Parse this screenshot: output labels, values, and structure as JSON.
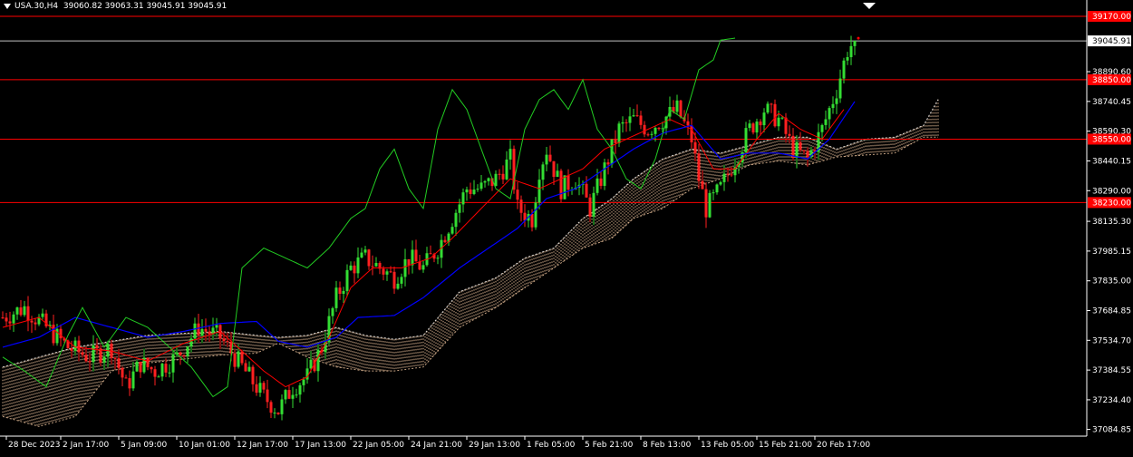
{
  "header": {
    "symbol": "USA.30,H4",
    "ohlc": "39060.82 39063.31 39045.91 39045.91"
  },
  "colors": {
    "background": "#000000",
    "axis": "#ffffff",
    "bull": "#33dd33",
    "bear": "#ff2020",
    "tenkan": "#ff0000",
    "kijun": "#0000ff",
    "chikou": "#22cc22",
    "cloud": "#f4c8a0",
    "hline": "#ff0000",
    "bid_line": "#c0c0c0"
  },
  "chart_data": {
    "type": "candlestick",
    "title": "USA.30,H4",
    "ylim": [
      37084.85,
      39200.0
    ],
    "y_ticks": [
      "39170.00",
      "39045.91",
      "38890.60",
      "38850.00",
      "38740.45",
      "38590.30",
      "38550.00",
      "38440.15",
      "38290.00",
      "38230.00",
      "38135.30",
      "37985.15",
      "37835.00",
      "37684.85",
      "37534.70",
      "37384.55",
      "37234.40",
      "37084.85"
    ],
    "y_tick_values": [
      39170.0,
      39045.91,
      38890.6,
      38850.0,
      38740.45,
      38590.3,
      38550.0,
      38440.15,
      38290.0,
      38230.0,
      38135.3,
      37985.15,
      37835.0,
      37684.85,
      37534.7,
      37384.55,
      37234.4,
      37084.85
    ],
    "x_ticks": [
      "28 Dec 2023",
      "2 Jan 17:00",
      "5 Jan 09:00",
      "10 Jan 01:00",
      "12 Jan 17:00",
      "17 Jan 13:00",
      "22 Jan 05:00",
      "24 Jan 21:00",
      "29 Jan 13:00",
      "1 Feb 05:00",
      "5 Feb 21:00",
      "8 Feb 13:00",
      "13 Feb 05:00",
      "15 Feb 21:00",
      "20 Feb 17:00"
    ],
    "x_tick_index": [
      1,
      16,
      32,
      48,
      64,
      80,
      96,
      112,
      128,
      144,
      160,
      176,
      192,
      208,
      224
    ],
    "horizontal_lines": [
      {
        "price": 39170.0,
        "label": "39170.00"
      },
      {
        "price": 38850.0,
        "label": "38850.00"
      },
      {
        "price": 38550.0,
        "label": "38550.00"
      },
      {
        "price": 38230.0,
        "label": "38230.00"
      }
    ],
    "bid": {
      "price": 39045.91,
      "label": "39045.91"
    },
    "close_path": [
      [
        0,
        37650
      ],
      [
        6,
        37700
      ],
      [
        12,
        37600
      ],
      [
        18,
        37500
      ],
      [
        24,
        37450
      ],
      [
        30,
        37500
      ],
      [
        34,
        37300
      ],
      [
        38,
        37420
      ],
      [
        42,
        37380
      ],
      [
        48,
        37450
      ],
      [
        54,
        37600
      ],
      [
        60,
        37550
      ],
      [
        64,
        37450
      ],
      [
        68,
        37350
      ],
      [
        72,
        37250
      ],
      [
        76,
        37180
      ],
      [
        80,
        37300
      ],
      [
        84,
        37350
      ],
      [
        88,
        37500
      ],
      [
        92,
        37750
      ],
      [
        96,
        37900
      ],
      [
        100,
        37950
      ],
      [
        104,
        37900
      ],
      [
        108,
        37850
      ],
      [
        112,
        37950
      ],
      [
        116,
        37900
      ],
      [
        120,
        38000
      ],
      [
        124,
        38150
      ],
      [
        128,
        38300
      ],
      [
        132,
        38300
      ],
      [
        136,
        38350
      ],
      [
        140,
        38450
      ],
      [
        142,
        38200
      ],
      [
        146,
        38150
      ],
      [
        148,
        38400
      ],
      [
        150,
        38500
      ],
      [
        154,
        38300
      ],
      [
        158,
        38350
      ],
      [
        162,
        38200
      ],
      [
        166,
        38400
      ],
      [
        170,
        38600
      ],
      [
        174,
        38650
      ],
      [
        178,
        38600
      ],
      [
        182,
        38650
      ],
      [
        186,
        38700
      ],
      [
        190,
        38550
      ],
      [
        192,
        38350
      ],
      [
        194,
        38200
      ],
      [
        198,
        38300
      ],
      [
        202,
        38450
      ],
      [
        206,
        38600
      ],
      [
        210,
        38700
      ],
      [
        214,
        38650
      ],
      [
        218,
        38500
      ],
      [
        222,
        38450
      ],
      [
        226,
        38600
      ],
      [
        230,
        38800
      ],
      [
        233,
        39000
      ],
      [
        235,
        39046
      ]
    ],
    "tenkan_path": [
      [
        0,
        37600
      ],
      [
        10,
        37650
      ],
      [
        20,
        37500
      ],
      [
        30,
        37480
      ],
      [
        40,
        37430
      ],
      [
        50,
        37520
      ],
      [
        60,
        37580
      ],
      [
        66,
        37480
      ],
      [
        72,
        37380
      ],
      [
        78,
        37300
      ],
      [
        84,
        37350
      ],
      [
        90,
        37550
      ],
      [
        96,
        37800
      ],
      [
        102,
        37900
      ],
      [
        110,
        37900
      ],
      [
        118,
        37950
      ],
      [
        124,
        38050
      ],
      [
        132,
        38200
      ],
      [
        140,
        38350
      ],
      [
        148,
        38300
      ],
      [
        154,
        38350
      ],
      [
        160,
        38400
      ],
      [
        166,
        38500
      ],
      [
        172,
        38550
      ],
      [
        178,
        38600
      ],
      [
        184,
        38650
      ],
      [
        190,
        38600
      ],
      [
        196,
        38400
      ],
      [
        202,
        38400
      ],
      [
        208,
        38550
      ],
      [
        214,
        38680
      ],
      [
        220,
        38600
      ],
      [
        226,
        38550
      ],
      [
        232,
        38700
      ]
    ],
    "kijun_path": [
      [
        0,
        37500
      ],
      [
        10,
        37550
      ],
      [
        20,
        37650
      ],
      [
        30,
        37600
      ],
      [
        40,
        37550
      ],
      [
        50,
        37580
      ],
      [
        60,
        37620
      ],
      [
        70,
        37630
      ],
      [
        76,
        37530
      ],
      [
        84,
        37500
      ],
      [
        92,
        37550
      ],
      [
        98,
        37650
      ],
      [
        108,
        37660
      ],
      [
        116,
        37750
      ],
      [
        126,
        37900
      ],
      [
        134,
        38000
      ],
      [
        142,
        38100
      ],
      [
        150,
        38250
      ],
      [
        158,
        38300
      ],
      [
        166,
        38400
      ],
      [
        174,
        38500
      ],
      [
        182,
        38580
      ],
      [
        190,
        38620
      ],
      [
        198,
        38450
      ],
      [
        206,
        38480
      ],
      [
        214,
        38480
      ],
      [
        222,
        38450
      ],
      [
        228,
        38550
      ],
      [
        235,
        38740
      ]
    ],
    "chikou_path": [
      [
        0,
        37450
      ],
      [
        6,
        37380
      ],
      [
        12,
        37300
      ],
      [
        18,
        37560
      ],
      [
        22,
        37700
      ],
      [
        28,
        37500
      ],
      [
        34,
        37650
      ],
      [
        40,
        37600
      ],
      [
        46,
        37500
      ],
      [
        52,
        37400
      ],
      [
        58,
        37250
      ],
      [
        62,
        37300
      ],
      [
        66,
        37900
      ],
      [
        72,
        38000
      ],
      [
        78,
        37950
      ],
      [
        84,
        37900
      ],
      [
        90,
        38000
      ],
      [
        96,
        38150
      ],
      [
        100,
        38200
      ],
      [
        104,
        38400
      ],
      [
        108,
        38500
      ],
      [
        112,
        38300
      ],
      [
        116,
        38200
      ],
      [
        120,
        38600
      ],
      [
        124,
        38800
      ],
      [
        128,
        38700
      ],
      [
        132,
        38500
      ],
      [
        136,
        38300
      ],
      [
        140,
        38250
      ],
      [
        144,
        38600
      ],
      [
        148,
        38750
      ],
      [
        152,
        38800
      ],
      [
        156,
        38700
      ],
      [
        160,
        38850
      ],
      [
        164,
        38600
      ],
      [
        168,
        38500
      ],
      [
        172,
        38350
      ],
      [
        176,
        38300
      ],
      [
        180,
        38450
      ],
      [
        184,
        38700
      ],
      [
        188,
        38650
      ],
      [
        192,
        38900
      ],
      [
        196,
        38950
      ],
      [
        198,
        39050
      ],
      [
        202,
        39060
      ]
    ],
    "cloud_top": [
      [
        0,
        37400
      ],
      [
        10,
        37450
      ],
      [
        20,
        37500
      ],
      [
        30,
        37530
      ],
      [
        40,
        37560
      ],
      [
        50,
        37570
      ],
      [
        60,
        37580
      ],
      [
        70,
        37560
      ],
      [
        76,
        37550
      ],
      [
        84,
        37560
      ],
      [
        92,
        37600
      ],
      [
        100,
        37560
      ],
      [
        108,
        37540
      ],
      [
        116,
        37560
      ],
      [
        126,
        37780
      ],
      [
        136,
        37850
      ],
      [
        144,
        37950
      ],
      [
        152,
        38000
      ],
      [
        160,
        38150
      ],
      [
        168,
        38250
      ],
      [
        174,
        38350
      ],
      [
        182,
        38450
      ],
      [
        190,
        38500
      ],
      [
        198,
        38480
      ],
      [
        206,
        38520
      ],
      [
        214,
        38560
      ],
      [
        222,
        38560
      ],
      [
        230,
        38500
      ],
      [
        238,
        38550
      ],
      [
        246,
        38560
      ],
      [
        254,
        38620
      ],
      [
        258,
        38750
      ]
    ],
    "cloud_bottom": [
      [
        0,
        37150
      ],
      [
        10,
        37100
      ],
      [
        20,
        37150
      ],
      [
        30,
        37380
      ],
      [
        40,
        37420
      ],
      [
        50,
        37440
      ],
      [
        60,
        37460
      ],
      [
        70,
        37470
      ],
      [
        76,
        37520
      ],
      [
        84,
        37450
      ],
      [
        92,
        37400
      ],
      [
        100,
        37380
      ],
      [
        108,
        37380
      ],
      [
        116,
        37400
      ],
      [
        126,
        37600
      ],
      [
        136,
        37700
      ],
      [
        144,
        37800
      ],
      [
        152,
        37900
      ],
      [
        160,
        38000
      ],
      [
        168,
        38050
      ],
      [
        174,
        38150
      ],
      [
        182,
        38200
      ],
      [
        190,
        38300
      ],
      [
        198,
        38350
      ],
      [
        206,
        38420
      ],
      [
        214,
        38440
      ],
      [
        222,
        38420
      ],
      [
        230,
        38460
      ],
      [
        238,
        38470
      ],
      [
        246,
        38480
      ],
      [
        254,
        38560
      ],
      [
        258,
        38560
      ]
    ]
  }
}
